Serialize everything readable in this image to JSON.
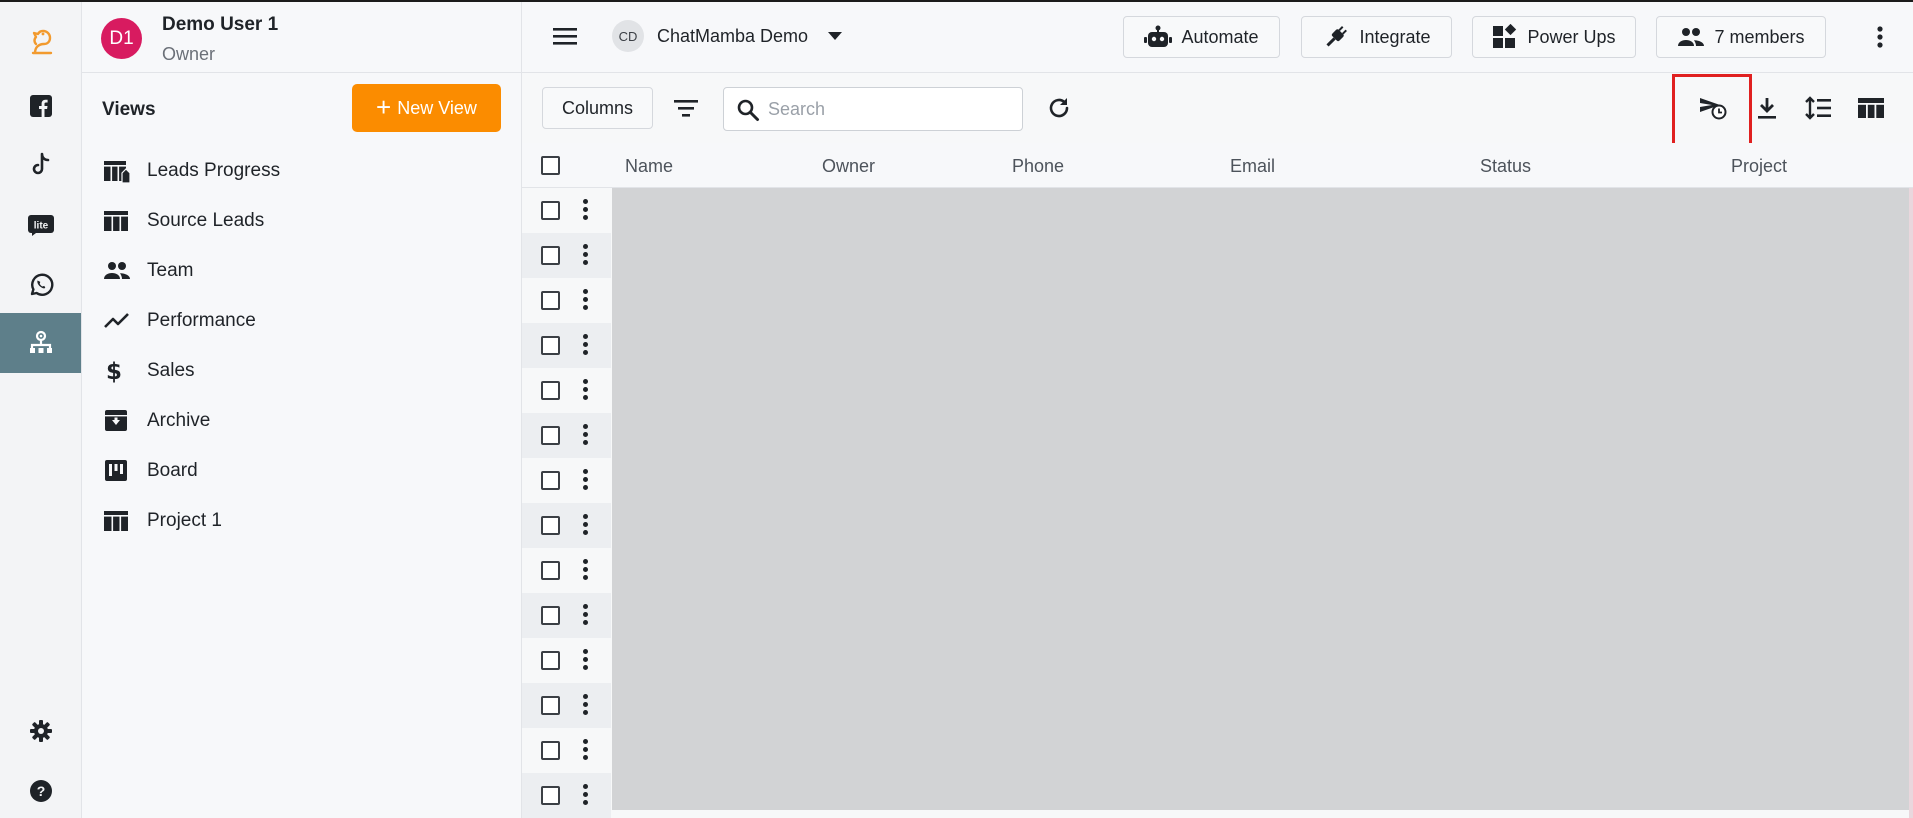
{
  "user": {
    "initials": "D1",
    "name": "Demo User 1",
    "role": "Owner"
  },
  "rail": {
    "items": [
      {
        "icon": "logo-icon"
      },
      {
        "icon": "facebook-icon"
      },
      {
        "icon": "tiktok-icon"
      },
      {
        "icon": "lite-icon",
        "label": "lite"
      },
      {
        "icon": "whatsapp-icon"
      },
      {
        "icon": "crm-hierarchy-icon",
        "active": true
      },
      {
        "icon": "settings-icon"
      },
      {
        "icon": "help-icon"
      }
    ]
  },
  "views": {
    "title": "Views",
    "new_view_label": "New View",
    "items": [
      {
        "label": "Leads Progress",
        "icon": "table-kanban-icon"
      },
      {
        "label": "Source Leads",
        "icon": "table-icon"
      },
      {
        "label": "Team",
        "icon": "people-icon"
      },
      {
        "label": "Performance",
        "icon": "trending-line-icon"
      },
      {
        "label": "Sales",
        "icon": "dollar-icon"
      },
      {
        "label": "Archive",
        "icon": "archive-icon"
      },
      {
        "label": "Board",
        "icon": "board-icon"
      },
      {
        "label": "Project 1",
        "icon": "table-icon"
      }
    ]
  },
  "header": {
    "workspace_initials": "CD",
    "workspace_name": "ChatMamba Demo",
    "buttons": [
      {
        "label": "Automate",
        "icon": "robot-icon"
      },
      {
        "label": "Integrate",
        "icon": "plug-icon"
      },
      {
        "label": "Power Ups",
        "icon": "widgets-icon"
      },
      {
        "label": "7 members",
        "icon": "people-icon"
      }
    ]
  },
  "toolbar": {
    "columns_label": "Columns",
    "search_placeholder": "Search",
    "right_icons": [
      "scheduled-send-icon",
      "download-icon",
      "row-height-icon",
      "table-layout-icon"
    ]
  },
  "table": {
    "columns": [
      "Name",
      "Owner",
      "Phone",
      "Email",
      "Status",
      "Project"
    ],
    "row_count": 14
  },
  "colors": {
    "accent": "#fb8c00",
    "avatar": "#d81b60",
    "rail_active": "#5e7f8a",
    "highlight": "#e02020",
    "loading_area": "#d2d3d5"
  }
}
